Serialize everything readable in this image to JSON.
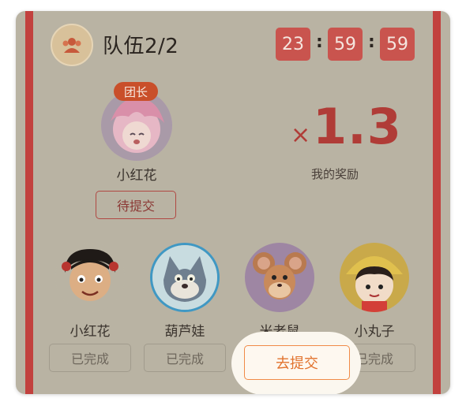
{
  "team": {
    "title": "队伍2/2",
    "icon": "team-users-icon"
  },
  "timer": {
    "hours": "23",
    "minutes": "59",
    "seconds": "59",
    "separator": ":"
  },
  "leader": {
    "tag": "团长",
    "name": "小红花",
    "action": "待提交"
  },
  "reward": {
    "multiplier_symbol": "×",
    "multiplier_value": "1.3",
    "label": "我的奖励"
  },
  "members": [
    {
      "name": "小红花",
      "action": "已完成"
    },
    {
      "name": "葫芦娃",
      "action": "已完成"
    },
    {
      "name": "米老鼠",
      "action": "去提交"
    },
    {
      "name": "小丸子",
      "action": "已完成"
    }
  ],
  "colors": {
    "card_bg": "#b9b3a3",
    "accent_red": "#c2413e",
    "submit_orange": "#e2732e"
  }
}
